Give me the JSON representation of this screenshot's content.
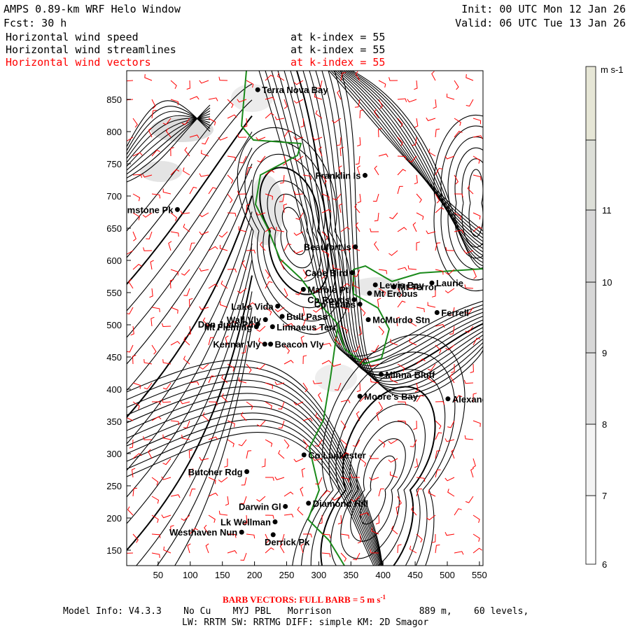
{
  "header": {
    "title": "AMPS 0.89-km WRF Helo Window",
    "forecast": "Fcst:   30 h",
    "init": "Init: 00 UTC Mon 12 Jan 26",
    "valid": "Valid: 06 UTC Tue 13 Jan 26",
    "fields": [
      {
        "name": "Horizontal wind speed",
        "level": "at k-index =  55",
        "color": "#000000"
      },
      {
        "name": "Horizontal wind streamlines",
        "level": "at k-index =  55",
        "color": "#000000"
      },
      {
        "name": "Horizontal wind vectors",
        "level": "at k-index =  55",
        "color": "#ff0000"
      }
    ]
  },
  "colorbar": {
    "units": "m s-1",
    "levels": [
      "6",
      "7",
      "8",
      "9",
      "10",
      "11"
    ],
    "colors": [
      "#ffffff",
      "#f4f4f4",
      "#e2e2e2",
      "#d7d7d7",
      "#d8d8d8",
      "#dddfd8",
      "#e6e6d6"
    ]
  },
  "chart_data": {
    "type": "map",
    "xlim": [
      0,
      555
    ],
    "ylim": [
      130,
      895
    ],
    "x_ticks": [
      "50",
      "100",
      "150",
      "200",
      "250",
      "300",
      "350",
      "400",
      "450",
      "500",
      "550"
    ],
    "y_ticks": [
      "150",
      "200",
      "250",
      "300",
      "350",
      "400",
      "450",
      "500",
      "550",
      "600",
      "650",
      "700",
      "750",
      "800",
      "850"
    ],
    "stations": [
      {
        "name": "Terra Nova Bay",
        "x": 205,
        "y": 865,
        "side": "right"
      },
      {
        "name": "Franklin Is",
        "x": 372,
        "y": 732,
        "side": "left"
      },
      {
        "name": "Brimstone Pk",
        "x": 80,
        "y": 679,
        "side": "left"
      },
      {
        "name": "Beaufort Is",
        "x": 357,
        "y": 621,
        "side": "left"
      },
      {
        "name": "Cape Bird",
        "x": 352,
        "y": 581,
        "side": "left"
      },
      {
        "name": "Lewis Bay",
        "x": 388,
        "y": 562,
        "side": "right"
      },
      {
        "name": "Mt Terror",
        "x": 417,
        "y": 559,
        "side": "right"
      },
      {
        "name": "Laurie",
        "x": 476,
        "y": 565,
        "side": "right"
      },
      {
        "name": "Marble Pt",
        "x": 276,
        "y": 555,
        "side": "right"
      },
      {
        "name": "Mt Erebus",
        "x": 379,
        "y": 549,
        "side": "right"
      },
      {
        "name": "Cp Royds",
        "x": 355,
        "y": 539,
        "side": "left"
      },
      {
        "name": "Cp Evans",
        "x": 364,
        "y": 532,
        "side": "left"
      },
      {
        "name": "Lake Vida",
        "x": 236,
        "y": 529,
        "side": "left"
      },
      {
        "name": "Ferrell",
        "x": 484,
        "y": 519,
        "side": "right"
      },
      {
        "name": "Wall Vly",
        "x": 217,
        "y": 508,
        "side": "left"
      },
      {
        "name": "Bull Pass",
        "x": 243,
        "y": 513,
        "side": "right"
      },
      {
        "name": "McMurdo Stn",
        "x": 377,
        "y": 508,
        "side": "right"
      },
      {
        "name": "Don Juan Pd",
        "x": 205,
        "y": 501,
        "side": "left"
      },
      {
        "name": "Linnaeus Terr",
        "x": 228,
        "y": 497,
        "side": "right"
      },
      {
        "name": "Mt Fleming",
        "x": 203,
        "y": 497,
        "side": "left"
      },
      {
        "name": "Kennar Vly",
        "x": 216,
        "y": 470,
        "side": "left"
      },
      {
        "name": "Beacon Vly",
        "x": 225,
        "y": 470,
        "side": "right"
      },
      {
        "name": "Minna Bluff",
        "x": 397,
        "y": 423,
        "side": "right"
      },
      {
        "name": "Moore's Bay",
        "x": 364,
        "y": 389,
        "side": "right"
      },
      {
        "name": "Alexander",
        "x": 501,
        "y": 385,
        "side": "right"
      },
      {
        "name": "Co Lankester",
        "x": 277,
        "y": 298,
        "side": "right"
      },
      {
        "name": "Butcher Rdg",
        "x": 188,
        "y": 272,
        "side": "left"
      },
      {
        "name": "Darwin Gl",
        "x": 248,
        "y": 218,
        "side": "left"
      },
      {
        "name": "Diamond Hill",
        "x": 284,
        "y": 223,
        "side": "right"
      },
      {
        "name": "Lk Wellman",
        "x": 232,
        "y": 194,
        "side": "left"
      },
      {
        "name": "Westhaven Nun",
        "x": 180,
        "y": 178,
        "side": "left"
      },
      {
        "name": "Derrick Pk",
        "x": 229,
        "y": 174,
        "side": "below"
      }
    ]
  },
  "footer": {
    "barb_note": "BARB VECTORS:  FULL BARB = 5 m s",
    "barb_exp": "-1",
    "model_info": "Model Info: V4.3.3    No Cu    MYJ PBL   Morrison                889 m,    60 levels,",
    "model_info2": "LW: RRTM SW: RRTMG   DIFF: simple KM: 2D Smagor"
  }
}
